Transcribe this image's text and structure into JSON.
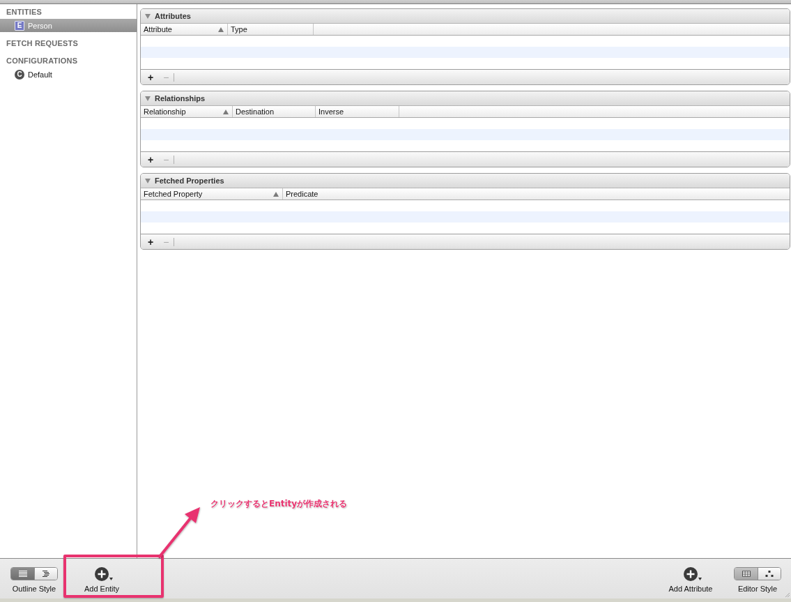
{
  "sidebar": {
    "sections": [
      {
        "title": "ENTITIES",
        "items": [
          {
            "kind": "entity",
            "badge": "E",
            "label": "Person",
            "selected": true
          }
        ]
      },
      {
        "title": "FETCH REQUESTS"
      },
      {
        "title": "CONFIGURATIONS",
        "items": [
          {
            "kind": "configuration",
            "badge": "C",
            "label": "Default",
            "selected": false
          }
        ]
      }
    ]
  },
  "panels": [
    {
      "title": "Attributes",
      "expanded": true,
      "columns": [
        {
          "label": "Attribute",
          "sorted": true
        },
        {
          "label": "Type",
          "sorted": false
        }
      ],
      "buttons": [
        {
          "kind": "add",
          "label": "+",
          "disabled": false
        },
        {
          "kind": "remove",
          "label": "−",
          "disabled": true
        }
      ]
    },
    {
      "title": "Relationships",
      "expanded": true,
      "columns": [
        {
          "label": "Relationship",
          "sorted": true
        },
        {
          "label": "Destination",
          "sorted": false
        },
        {
          "label": "Inverse",
          "sorted": false
        }
      ],
      "buttons": [
        {
          "kind": "add",
          "label": "+",
          "disabled": false
        },
        {
          "kind": "remove",
          "label": "−",
          "disabled": true
        }
      ]
    },
    {
      "title": "Fetched Properties",
      "expanded": true,
      "columns": [
        {
          "label": "Fetched Property",
          "sorted": true
        },
        {
          "label": "Predicate",
          "sorted": false
        }
      ],
      "buttons": [
        {
          "kind": "add",
          "label": "+",
          "disabled": false
        },
        {
          "kind": "remove",
          "label": "−",
          "disabled": true
        }
      ]
    }
  ],
  "toolbar": {
    "left": [
      {
        "kind": "segmented",
        "label": "Outline Style",
        "segments": [
          {
            "selected": true
          },
          {
            "selected": false
          }
        ]
      },
      {
        "kind": "add",
        "label": "Add Entity"
      }
    ],
    "right": [
      {
        "kind": "add",
        "label": "Add Attribute"
      },
      {
        "kind": "segmented",
        "label": "Editor Style",
        "segments": [
          {
            "selected": true
          },
          {
            "selected": false
          }
        ]
      }
    ]
  },
  "annotation": {
    "text": "クリックするとEntityが作成される"
  }
}
